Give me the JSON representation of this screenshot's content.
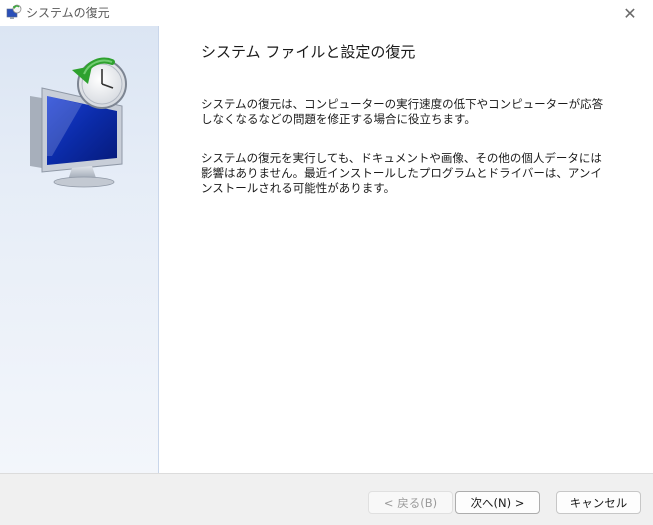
{
  "window": {
    "title": "システムの復元",
    "close_glyph": "✕"
  },
  "sidebar": {
    "icon": "system-restore-icon"
  },
  "content": {
    "heading": "システム ファイルと設定の復元",
    "paragraph1": "システムの復元は、コンピューターの実行速度の低下やコンピューターが応答しなくなるなどの問題を修正する場合に役立ちます。",
    "paragraph2": "システムの復元を実行しても、ドキュメントや画像、その他の個人データには影響はありません。最近インストールしたプログラムとドライバーは、アンインストールされる可能性があります。"
  },
  "footer": {
    "back_label": "< 戻る(B)",
    "next_label": "次へ(N) >",
    "cancel_label": "キャンセル"
  },
  "colors": {
    "sidebar_top": "#dbe5f3",
    "sidebar_bottom": "#f3f6fb",
    "footer_bg": "#f0f0f0"
  }
}
